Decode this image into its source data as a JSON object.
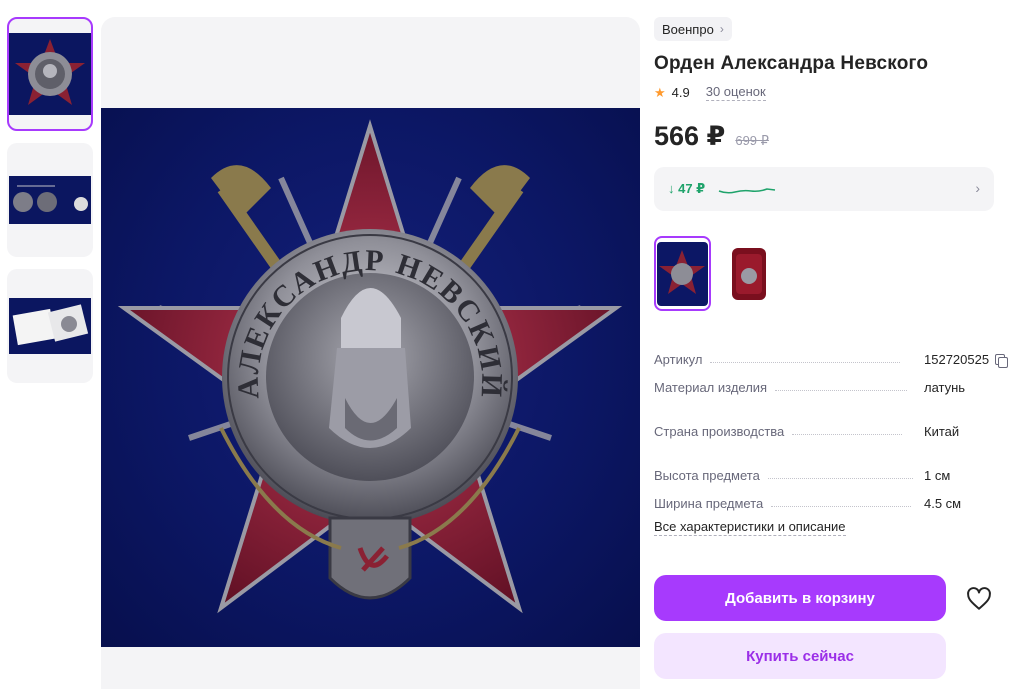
{
  "breadcrumb": {
    "brand": "Военпро"
  },
  "product": {
    "title": "Орден Александра Невского",
    "rating": "4.9",
    "reviews": "30 оценок",
    "price": "566 ₽",
    "old_price": "699 ₽",
    "price_drop": "↓ 47 ₽"
  },
  "gallery": {
    "thumbnails": [
      "order-front",
      "order-with-ruler",
      "order-in-box"
    ],
    "active_index": 0,
    "main_image": "order-of-alexander-nevsky",
    "medal_inscription": "АЛЕКСАНДР НЕВСКИЙ"
  },
  "variants": {
    "items": [
      "order",
      "order-in-red-case"
    ],
    "active_index": 0
  },
  "specs": [
    {
      "key": "Артикул",
      "value": "152720525",
      "copy": true
    },
    {
      "key": "Материал изделия",
      "value": "латунь"
    },
    {
      "key": "Страна производства",
      "value": "Китай"
    },
    {
      "key": "Высота предмета",
      "value": "1 см"
    },
    {
      "key": "Ширина предмета",
      "value": "4.5 см"
    }
  ],
  "all_specs_link": "Все характеристики и описание",
  "actions": {
    "add_to_cart": "Добавить в корзину",
    "buy_now": "Купить сейчас"
  },
  "colors": {
    "accent": "#a73afd",
    "accent_light": "#f3e5ff",
    "price_drop": "#1fa36b",
    "star": "#ff9a2e"
  }
}
